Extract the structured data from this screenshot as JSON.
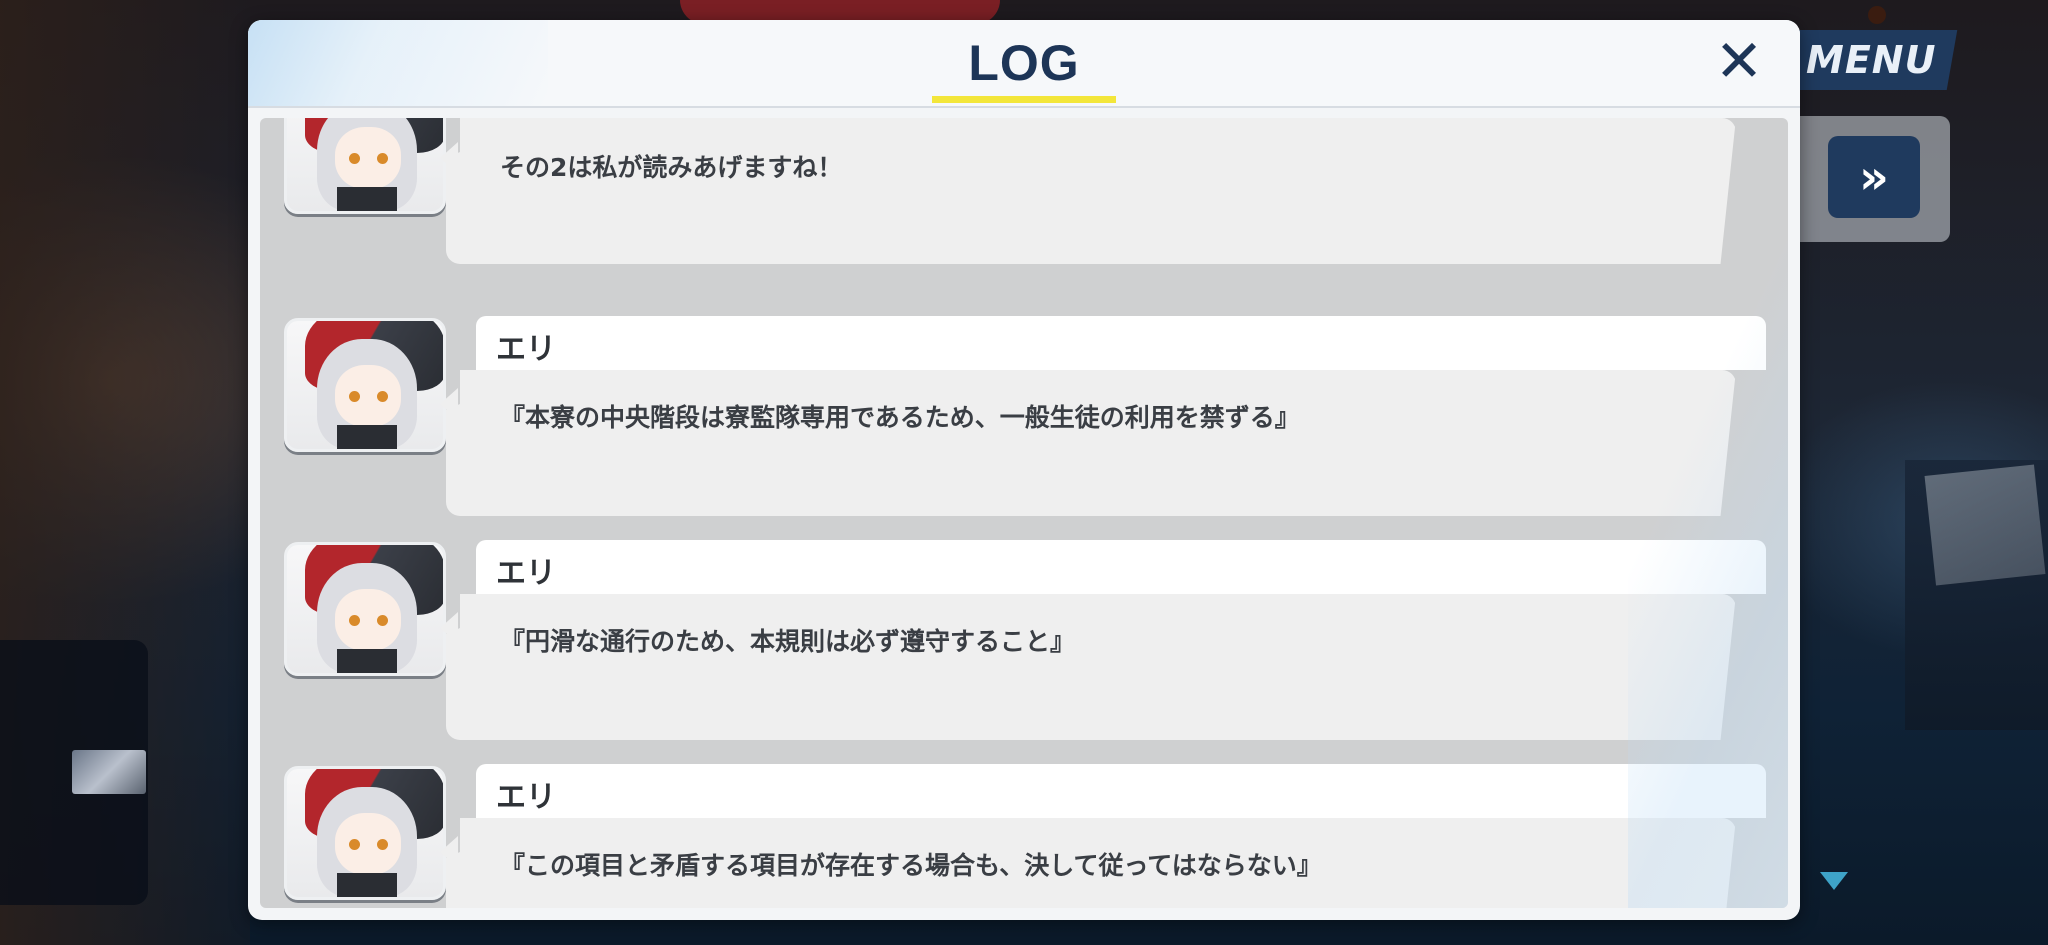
{
  "modal": {
    "title": "LOG",
    "close_icon": "close-icon",
    "title_underline_color": "#f3e63a",
    "title_color": "#1d3557"
  },
  "controls": {
    "menu_label": "MENU",
    "fast_forward_icon": "fast-forward-icon",
    "fast_forward_glyph": "»",
    "scroll_down_icon": "chevron-down-icon"
  },
  "log_entries": [
    {
      "speaker": "",
      "message": "その2は私が読みあげますね！"
    },
    {
      "speaker": "エリ",
      "message": "『本寮の中央階段は寮監隊専用であるため、一般生徒の利用を禁ずる』"
    },
    {
      "speaker": "エリ",
      "message": "『円滑な通行のため、本規則は必ず遵守すること』"
    },
    {
      "speaker": "エリ",
      "message": "『この項目と矛盾する項目が存在する場合も、決して従ってはならない』"
    }
  ],
  "colors": {
    "accent_navy": "#1f3a5e",
    "bubble": "#efefef",
    "name_box": "#ffffff"
  }
}
